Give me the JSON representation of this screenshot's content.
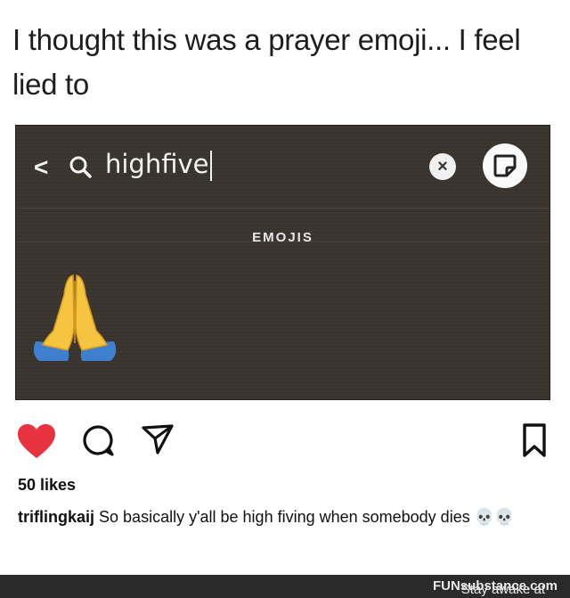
{
  "caption": "I thought this was a prayer emoji... I feel lied to",
  "search": {
    "back_glyph": "<",
    "query": "highfive",
    "section_label": "EMOJIS",
    "result_emoji": "folded-hands-emoji",
    "clear_glyph": "×"
  },
  "post": {
    "likes": "50 likes",
    "username": "triflingkaij",
    "caption_text": "So basically y'all be high fiving when somebody dies 💀💀"
  },
  "watermark": {
    "prefix": "Stay awake at ",
    "brand": "FUNsubstance.com"
  },
  "colors": {
    "screen_bg": "#3a342f",
    "like_red": "#e8323f",
    "footer_bg": "#2a2a2a"
  },
  "icons": [
    "search-icon",
    "clear-icon",
    "sticker-icon",
    "heart-icon",
    "comment-icon",
    "share-icon",
    "bookmark-icon"
  ]
}
